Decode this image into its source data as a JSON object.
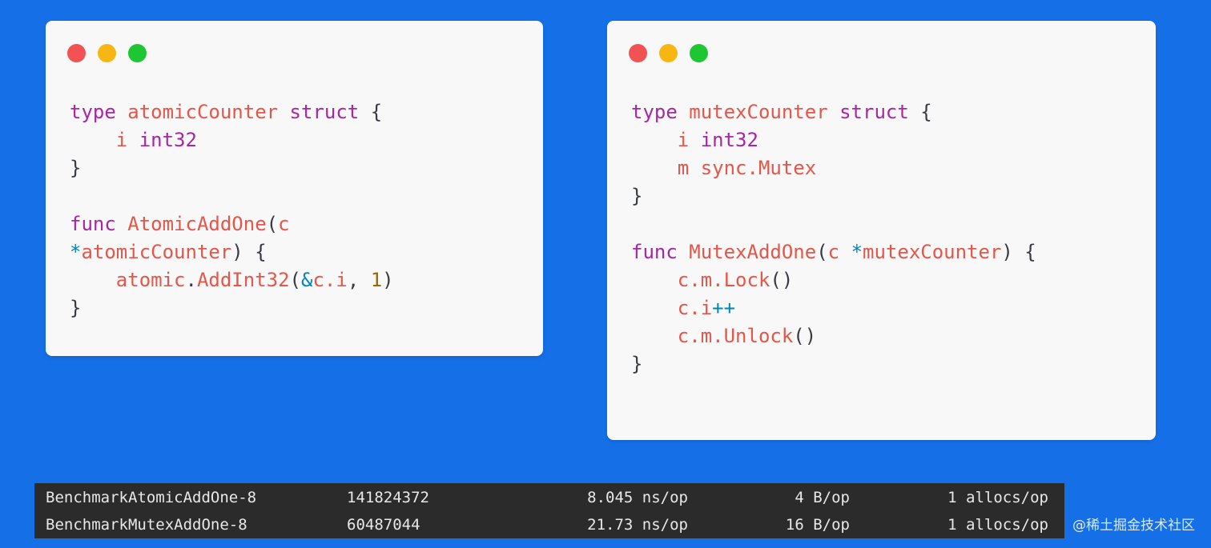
{
  "colors": {
    "background": "#1570e8",
    "dot_close": "#f25252",
    "dot_minimize": "#f8b613",
    "dot_maximize": "#1ec732",
    "keyword": "#a626a4",
    "type": "#e45649",
    "operator": "#0184bc",
    "number": "#986801",
    "punct": "#383a42",
    "terminal_bg": "#2b2b2b"
  },
  "code_left": {
    "lines": [
      [
        {
          "t": "type",
          "c": "kw"
        },
        {
          "t": " ",
          "c": "pn"
        },
        {
          "t": "atomicCounter",
          "c": "ty"
        },
        {
          "t": " ",
          "c": "pn"
        },
        {
          "t": "struct",
          "c": "kw"
        },
        {
          "t": " {",
          "c": "pn"
        }
      ],
      [
        {
          "t": "    ",
          "c": "pn"
        },
        {
          "t": "i",
          "c": "va"
        },
        {
          "t": " ",
          "c": "pn"
        },
        {
          "t": "int32",
          "c": "kw"
        }
      ],
      [
        {
          "t": "}",
          "c": "pn"
        }
      ],
      [],
      [
        {
          "t": "func",
          "c": "kw"
        },
        {
          "t": " ",
          "c": "pn"
        },
        {
          "t": "AtomicAddOne",
          "c": "fn"
        },
        {
          "t": "(",
          "c": "pn"
        },
        {
          "t": "c",
          "c": "va"
        }
      ],
      [
        {
          "t": "*",
          "c": "op"
        },
        {
          "t": "atomicCounter",
          "c": "ty"
        },
        {
          "t": ") {",
          "c": "pn"
        }
      ],
      [
        {
          "t": "    ",
          "c": "pn"
        },
        {
          "t": "atomic",
          "c": "va"
        },
        {
          "t": ".",
          "c": "pn"
        },
        {
          "t": "AddInt32",
          "c": "fn"
        },
        {
          "t": "(",
          "c": "pn"
        },
        {
          "t": "&",
          "c": "op"
        },
        {
          "t": "c.i",
          "c": "va"
        },
        {
          "t": ", ",
          "c": "pn"
        },
        {
          "t": "1",
          "c": "num"
        },
        {
          "t": ")",
          "c": "pn"
        }
      ],
      [
        {
          "t": "}",
          "c": "pn"
        }
      ]
    ]
  },
  "code_right": {
    "lines": [
      [
        {
          "t": "type",
          "c": "kw"
        },
        {
          "t": " ",
          "c": "pn"
        },
        {
          "t": "mutexCounter",
          "c": "ty"
        },
        {
          "t": " ",
          "c": "pn"
        },
        {
          "t": "struct",
          "c": "kw"
        },
        {
          "t": " {",
          "c": "pn"
        }
      ],
      [
        {
          "t": "    ",
          "c": "pn"
        },
        {
          "t": "i",
          "c": "va"
        },
        {
          "t": " ",
          "c": "pn"
        },
        {
          "t": "int32",
          "c": "kw"
        }
      ],
      [
        {
          "t": "    ",
          "c": "pn"
        },
        {
          "t": "m",
          "c": "va"
        },
        {
          "t": " ",
          "c": "pn"
        },
        {
          "t": "sync.Mutex",
          "c": "ty"
        }
      ],
      [
        {
          "t": "}",
          "c": "pn"
        }
      ],
      [],
      [
        {
          "t": "func",
          "c": "kw"
        },
        {
          "t": " ",
          "c": "pn"
        },
        {
          "t": "MutexAddOne",
          "c": "fn"
        },
        {
          "t": "(",
          "c": "pn"
        },
        {
          "t": "c",
          "c": "va"
        },
        {
          "t": " ",
          "c": "pn"
        },
        {
          "t": "*",
          "c": "op"
        },
        {
          "t": "mutexCounter",
          "c": "ty"
        },
        {
          "t": ") {",
          "c": "pn"
        }
      ],
      [
        {
          "t": "    ",
          "c": "pn"
        },
        {
          "t": "c.m.Lock",
          "c": "fn"
        },
        {
          "t": "()",
          "c": "pn"
        }
      ],
      [
        {
          "t": "    ",
          "c": "pn"
        },
        {
          "t": "c.i",
          "c": "va"
        },
        {
          "t": "++",
          "c": "op"
        }
      ],
      [
        {
          "t": "    ",
          "c": "pn"
        },
        {
          "t": "c.m.Unlock",
          "c": "fn"
        },
        {
          "t": "()",
          "c": "pn"
        }
      ],
      [
        {
          "t": "}",
          "c": "pn"
        }
      ]
    ]
  },
  "benchmark": {
    "rows": [
      {
        "name": "BenchmarkAtomicAddOne-8",
        "iterations": "141824372",
        "ns_op": "8.045 ns/op",
        "b_op": "4 B/op",
        "allocs_op": "1 allocs/op"
      },
      {
        "name": "BenchmarkMutexAddOne-8",
        "iterations": "60487044",
        "ns_op": "21.73 ns/op",
        "b_op": "16 B/op",
        "allocs_op": "1 allocs/op"
      }
    ]
  },
  "watermark": "@稀土掘金技术社区"
}
